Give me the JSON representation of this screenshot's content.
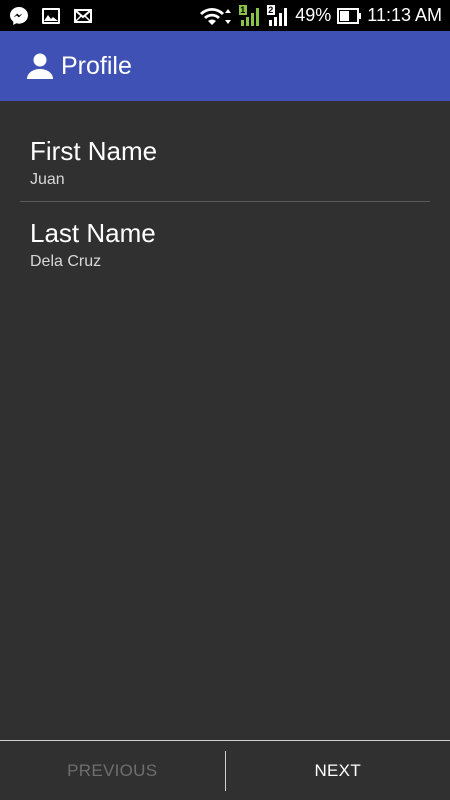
{
  "status_bar": {
    "left_icons": [
      "messenger-icon",
      "image-icon",
      "mail-icon"
    ],
    "right_icons": [
      "wifi-icon",
      "signal-sim1-icon",
      "signal-sim2-icon",
      "battery-icon"
    ],
    "sim1_label": "1",
    "sim2_label": "2",
    "battery_percent": "49%",
    "time": "11:13 AM"
  },
  "app_bar": {
    "title": "Profile",
    "icon": "person-icon",
    "color": "#3f51b5"
  },
  "fields": [
    {
      "label": "First Name",
      "value": "Juan"
    },
    {
      "label": "Last Name",
      "value": "Dela Cruz"
    }
  ],
  "bottom_nav": {
    "previous_label": "PREVIOUS",
    "next_label": "NEXT"
  },
  "colors": {
    "background": "#303030",
    "status_bar": "#000000",
    "signal_sim1": "#8bc34a"
  }
}
